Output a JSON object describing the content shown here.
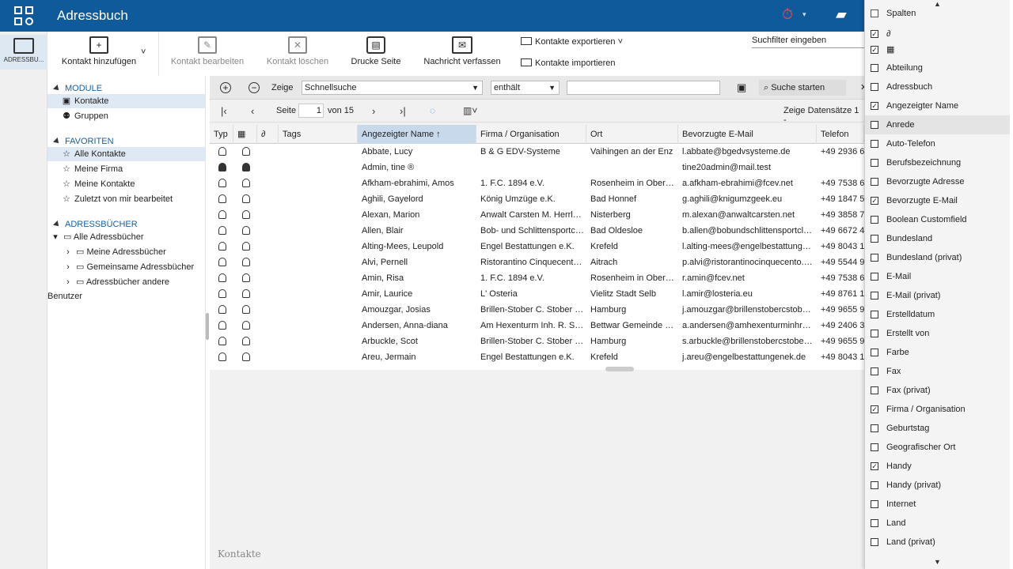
{
  "app": {
    "title": "Adressbuch",
    "module_label": "ADRESSBU..."
  },
  "toolbar": {
    "add": "Kontakt hinzufügen",
    "edit": "Kontakt bearbeiten",
    "delete": "Kontakt löschen",
    "print": "Drucke Seite",
    "message": "Nachricht verfassen",
    "export": "Kontakte exportieren",
    "import": "Kontakte importieren",
    "search_filter": "Suchfilter eingeben"
  },
  "sidebar": {
    "modules_header": "MODULE",
    "modules": [
      "Kontakte",
      "Gruppen"
    ],
    "favorites_header": "FAVORITEN",
    "favorites": [
      "Alle Kontakte",
      "Meine Firma",
      "Meine Kontakte",
      "Zuletzt von mir bearbeitet"
    ],
    "books_header": "ADRESSBÜCHER",
    "books_root": "Alle Adressbücher",
    "books": [
      "Meine Adressbücher",
      "Gemeinsame Adressbücher",
      "Adressbücher andere Benutzer"
    ]
  },
  "search": {
    "show_label": "Zeige",
    "mode": "Schnellsuche",
    "operator": "enthält",
    "value": "",
    "start": "Suche starten"
  },
  "pager": {
    "page_label": "Seite",
    "page": "1",
    "of": "von 15",
    "records": "Zeige Datensätze 1 -"
  },
  "grid": {
    "columns": [
      "Typ",
      "",
      "",
      "Tags",
      "Angezeigter Name",
      "Firma / Organisation",
      "Ort",
      "Bevorzugte E-Mail",
      "Telefon"
    ],
    "rows": [
      [
        "Abbate, Lucy",
        "B & G EDV-Systeme",
        "Vaihingen an der Enz",
        "l.abbate@bgedvsysteme.de",
        "+49 2936 6"
      ],
      [
        "Admin, tine ®",
        "",
        "",
        "tine20admin@mail.test",
        ""
      ],
      [
        "Afkham-ebrahimi, Amos",
        "1. F.C. 1894 e.V.",
        "Rosenheim in Ober…",
        "a.afkham-ebrahimi@fcev.net",
        "+49 7538 6"
      ],
      [
        "Aghili, Gayelord",
        "König Umzüge e.K.",
        "Bad Honnef",
        "g.aghili@knigumzgeek.eu",
        "+49 1847 5"
      ],
      [
        "Alexan, Marion",
        "Anwalt Carsten M. Herrl…",
        "Nisterberg",
        "m.alexan@anwaltcarsten.net",
        "+49 3858 7"
      ],
      [
        "Allen, Blair",
        "Bob- und Schlittensportc…",
        "Bad Oldesloe",
        "b.allen@bobundschlittensportcl…",
        "+49 6672 4"
      ],
      [
        "Alting-Mees, Leupold",
        "Engel Bestattungen e.K.",
        "Krefeld",
        "l.alting-mees@engelbestattung…",
        "+49 8043 1"
      ],
      [
        "Alvi, Pernell",
        "Ristorantino Cinquecent…",
        "Aitrach",
        "p.alvi@ristorantinocinquecento.…",
        "+49 5544 9"
      ],
      [
        "Amin, Risa",
        "1. F.C. 1894 e.V.",
        "Rosenheim in Ober…",
        "r.amin@fcev.net",
        "+49 7538 6"
      ],
      [
        "Amir, Laurice",
        "L' Osteria",
        "Vielitz Stadt Selb",
        "l.amir@losteria.eu",
        "+49 8761 1"
      ],
      [
        "Amouzgar, Josias",
        "Brillen-Stober C. Stober …",
        "Hamburg",
        "j.amouzgar@brillenstobercstob…",
        "+49 9655 9"
      ],
      [
        "Andersen, Anna-diana",
        "Am Hexenturm Inh. R. S…",
        "Bettwar Gemeinde …",
        "a.andersen@amhexenturminhr…",
        "+49 2406 3"
      ],
      [
        "Arbuckle, Scot",
        "Brillen-Stober C. Stober …",
        "Hamburg",
        "s.arbuckle@brillenstobercstobe…",
        "+49 9655 9"
      ],
      [
        "Areu, Jermain",
        "Engel Bestattungen e.K.",
        "Krefeld",
        "j.areu@engelbestattungenek.de",
        "+49 8043 1"
      ]
    ],
    "footer_label": "Kontakte"
  },
  "columns_menu": {
    "header": "Spalten",
    "items": [
      {
        "label": "",
        "checked": true,
        "icon": "paperclip-icon"
      },
      {
        "label": "",
        "checked": true,
        "icon": "image-icon"
      },
      {
        "label": "Abteilung",
        "checked": false
      },
      {
        "label": "Adressbuch",
        "checked": false
      },
      {
        "label": "Angezeigter Name",
        "checked": true
      },
      {
        "label": "Anrede",
        "checked": false
      },
      {
        "label": "Auto-Telefon",
        "checked": false
      },
      {
        "label": "Berufsbezeichnung",
        "checked": false
      },
      {
        "label": "Bevorzugte Adresse",
        "checked": false
      },
      {
        "label": "Bevorzugte E-Mail",
        "checked": true
      },
      {
        "label": "Boolean Customfield",
        "checked": false
      },
      {
        "label": "Bundesland",
        "checked": false
      },
      {
        "label": "Bundesland (privat)",
        "checked": false
      },
      {
        "label": "E-Mail",
        "checked": false
      },
      {
        "label": "E-Mail (privat)",
        "checked": false
      },
      {
        "label": "Erstelldatum",
        "checked": false
      },
      {
        "label": "Erstellt von",
        "checked": false
      },
      {
        "label": "Farbe",
        "checked": false
      },
      {
        "label": "Fax",
        "checked": false
      },
      {
        "label": "Fax (privat)",
        "checked": false
      },
      {
        "label": "Firma / Organisation",
        "checked": true
      },
      {
        "label": "Geburtstag",
        "checked": false
      },
      {
        "label": "Geografischer Ort",
        "checked": false
      },
      {
        "label": "Handy",
        "checked": true
      },
      {
        "label": "Handy (privat)",
        "checked": false
      },
      {
        "label": "Internet",
        "checked": false
      },
      {
        "label": "Land",
        "checked": false
      },
      {
        "label": "Land (privat)",
        "checked": false
      }
    ]
  }
}
